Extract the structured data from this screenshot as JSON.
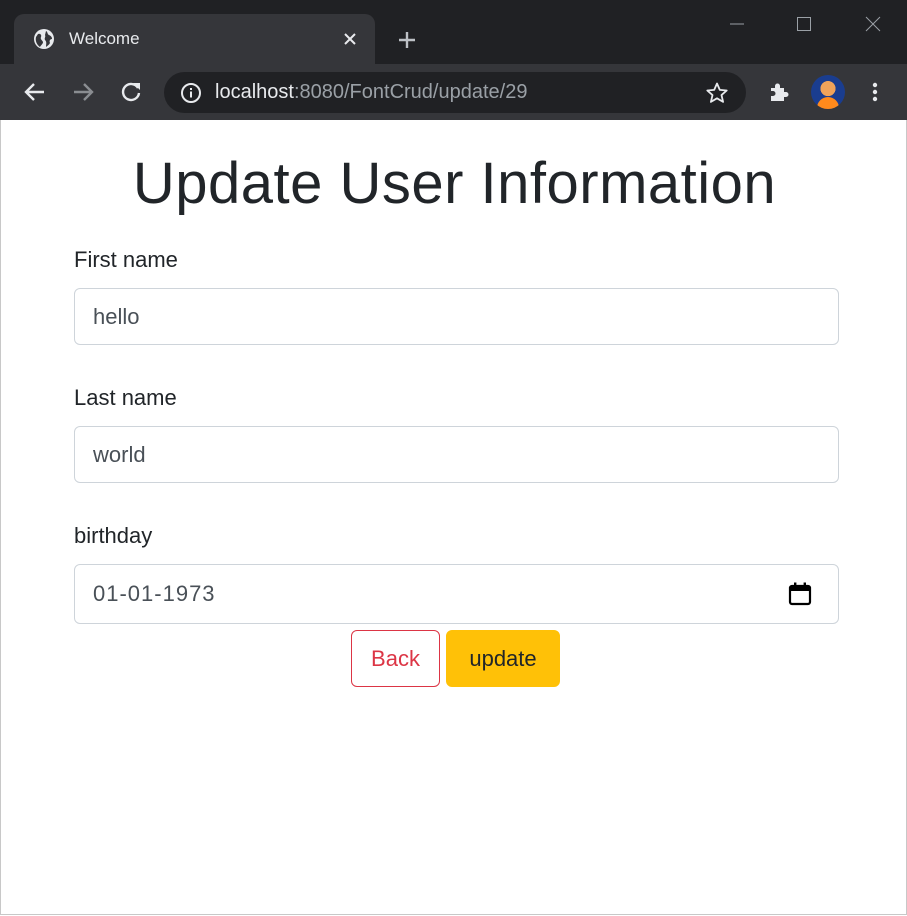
{
  "browser": {
    "tab_title": "Welcome",
    "url_host": "localhost",
    "url_rest": ":8080/FontCrud/update/29",
    "icons": {
      "favicon": "globe-icon",
      "tab_close": "close-icon",
      "new_tab": "plus-icon",
      "back": "back-arrow-icon",
      "forward": "forward-arrow-icon",
      "reload": "reload-icon",
      "site_info": "info-icon",
      "bookmark": "star-icon",
      "extensions": "puzzle-icon",
      "menu": "kebab-menu-icon"
    }
  },
  "page": {
    "title": "Update User Information",
    "form": {
      "first_name": {
        "label": "First name",
        "value": "hello"
      },
      "last_name": {
        "label": "Last name",
        "value": "world"
      },
      "birthday": {
        "label": "birthday",
        "value": "01-01-1973"
      }
    },
    "buttons": {
      "back": "Back",
      "update": "update"
    }
  },
  "colors": {
    "chrome_dark": "#202124",
    "chrome_toolbar": "#35363a",
    "danger": "#dc3545",
    "warning": "#ffc107",
    "text": "#212529"
  }
}
